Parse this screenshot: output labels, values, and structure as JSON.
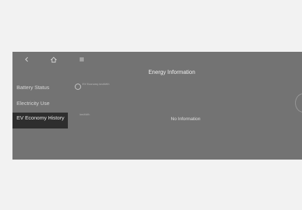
{
  "header": {
    "title": "Energy Information",
    "nav_icons": [
      "back-icon",
      "home-icon",
      "menu-icon"
    ]
  },
  "sidebar": {
    "items": [
      {
        "label": "Battery Status",
        "active": false
      },
      {
        "label": "Electricity Use",
        "active": false
      },
      {
        "label": "EV Economy History",
        "active": true
      }
    ]
  },
  "main": {
    "ev_badge_text": "EV Economy km/kWh",
    "unit_label": "km/kWh",
    "empty_message": "No Information"
  },
  "colors": {
    "page_background": "#f2f2f2",
    "screen_background": "#737373",
    "active_item_background": "#2e2e2e",
    "text": "#e3e3e3"
  }
}
